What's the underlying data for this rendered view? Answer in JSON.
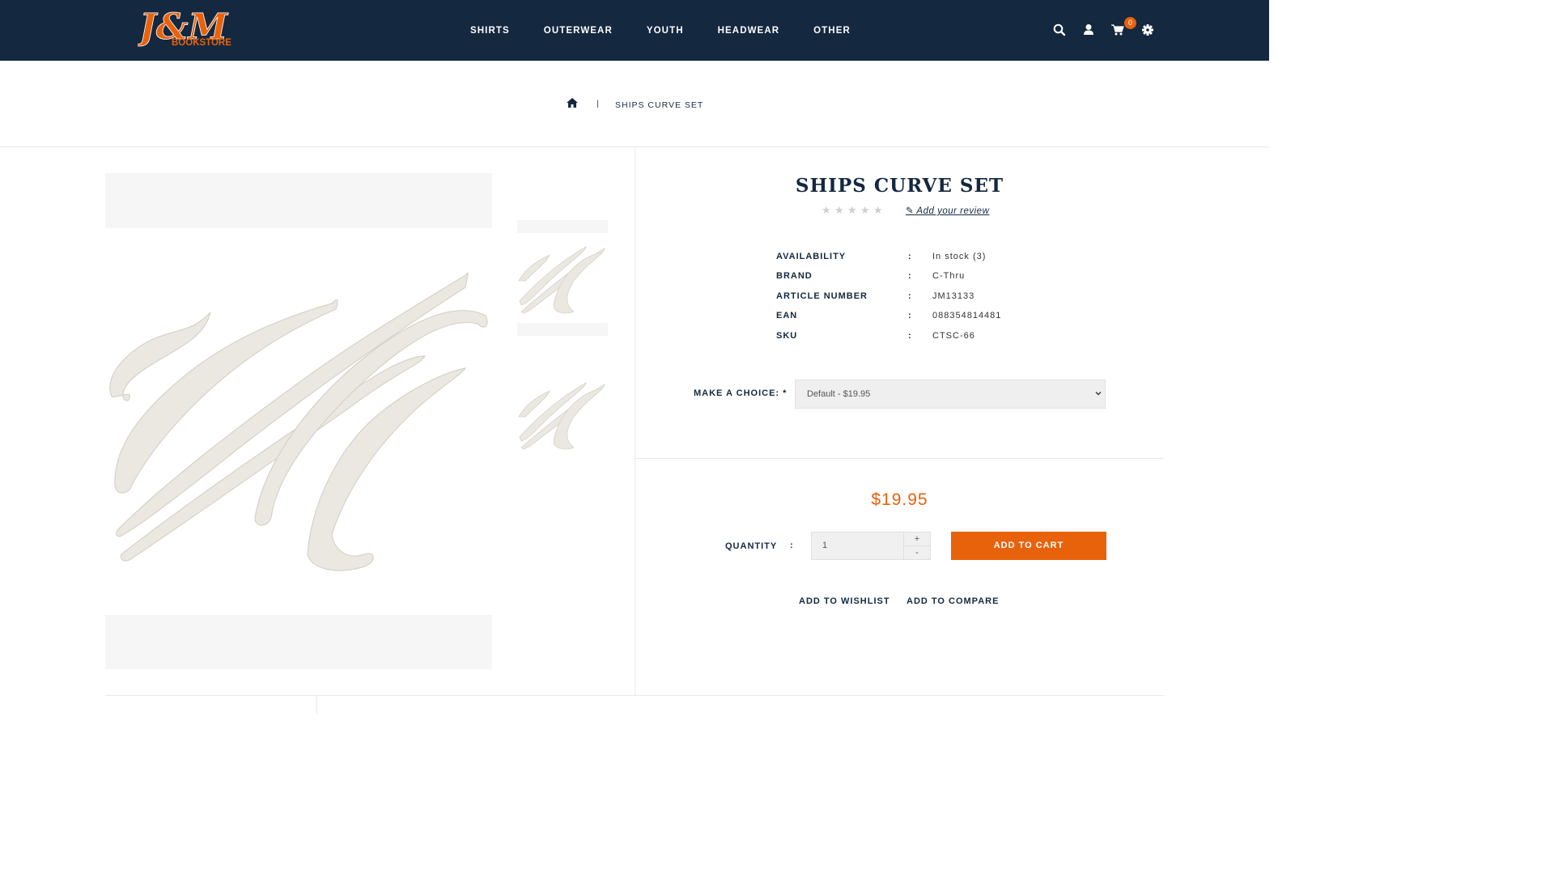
{
  "header": {
    "logo_initials": "J&M",
    "logo_text": "BOOKSTORE",
    "nav": [
      "SHIRTS",
      "OUTERWEAR",
      "YOUTH",
      "HEADWEAR",
      "OTHER"
    ],
    "icons": [
      "search-icon",
      "user-icon",
      "cart-icon",
      "gear-icon"
    ],
    "cart_count": "0"
  },
  "breadcrumb": {
    "separator": "|",
    "current": "SHIPS CURVE SET"
  },
  "product": {
    "title": "SHIPS CURVE SET",
    "rating": 0,
    "rating_max": 5,
    "review_link": "Add your review",
    "specs": [
      {
        "label": "AVAILABILITY",
        "value": "In stock (3)"
      },
      {
        "label": "BRAND",
        "value": "C-Thru"
      },
      {
        "label": "ARTICLE NUMBER",
        "value": "JM13133"
      },
      {
        "label": "EAN",
        "value": "088354814481"
      },
      {
        "label": "SKU",
        "value": "CTSC-66"
      }
    ],
    "spec_separator": ":",
    "choice_label": "MAKE A CHOICE: *",
    "choice_value": "Default - $19.95",
    "price": "$19.95",
    "quantity_label": "QUANTITY",
    "quantity_value": "1",
    "plus": "+",
    "minus": "-",
    "add_to_cart": "ADD TO CART",
    "add_to_wishlist": "ADD TO WISHLIST",
    "add_to_compare": "ADD TO COMPARE"
  },
  "colors": {
    "navy": "#142840",
    "accent": "#e8620c"
  }
}
